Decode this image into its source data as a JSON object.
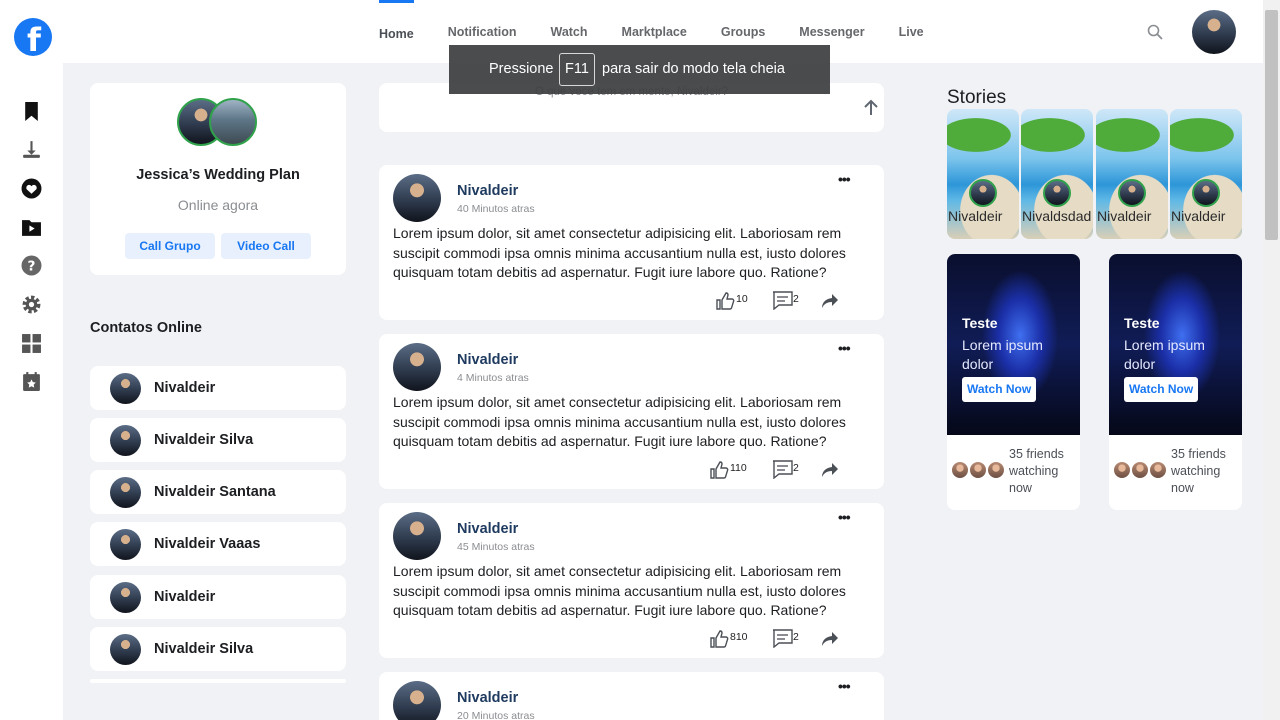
{
  "app": {
    "logo_letter": "f"
  },
  "nav": {
    "items": [
      "Home",
      "Notification",
      "Watch",
      "Marktplace",
      "Groups",
      "Messenger",
      "Live"
    ],
    "active": "Home"
  },
  "rail_icons": [
    "bookmark-icon",
    "upload-icon",
    "heart-icon",
    "video-folder-icon",
    "help-icon",
    "settings-icon",
    "grid-icon",
    "calendar-icon"
  ],
  "profile": {
    "name": "Jessica’s Wedding Plan",
    "status": "Online agora",
    "call_group_label": "Call Grupo",
    "video_call_label": "Video Call"
  },
  "contacts": {
    "title": "Contatos Online",
    "items": [
      "Nivaldeir",
      "Nivaldeir Silva",
      "Nivaldeir Santana",
      "Nivaldeir Vaaas",
      "Nivaldeir",
      "Nivaldeir Silva"
    ]
  },
  "composer": {
    "placeholder": "O que voce tem em mente, Nivaldeir?"
  },
  "toast": {
    "before": "Pressione",
    "key": "F11",
    "after": "para sair do modo tela cheia"
  },
  "posts": [
    {
      "author": "Nivaldeir",
      "time": "40 Minutos atras",
      "text": "Lorem ipsum dolor, sit amet consectetur adipisicing elit. Laboriosam rem suscipit commodi ipsa omnis minima accusantium nulla est, iusto dolores quisquam totam debitis ad aspernatur. Fugit iure labore quo. Ratione?",
      "likes": "10",
      "comments": "2"
    },
    {
      "author": "Nivaldeir",
      "time": "4 Minutos atras",
      "text": "Lorem ipsum dolor, sit amet consectetur adipisicing elit. Laboriosam rem suscipit commodi ipsa omnis minima accusantium nulla est, iusto dolores quisquam totam debitis ad aspernatur. Fugit iure labore quo. Ratione?",
      "likes": "110",
      "comments": "2"
    },
    {
      "author": "Nivaldeir",
      "time": "45 Minutos atras",
      "text": "Lorem ipsum dolor, sit amet consectetur adipisicing elit. Laboriosam rem suscipit commodi ipsa omnis minima accusantium nulla est, iusto dolores quisquam totam debitis ad aspernatur. Fugit iure labore quo. Ratione?",
      "likes": "810",
      "comments": "2"
    },
    {
      "author": "Nivaldeir",
      "time": "20 Minutos atras",
      "text": "",
      "likes": "",
      "comments": ""
    }
  ],
  "stories": {
    "title": "Stories",
    "items": [
      "Nivaldeir",
      "Nivaldsdad",
      "Nivaldeir",
      "Nivaldeir"
    ]
  },
  "watch_cards": [
    {
      "title": "Teste",
      "subtitle": "Lorem ipsum dolor",
      "button": "Watch Now",
      "friends_text": "35 friends watching now"
    },
    {
      "title": "Teste",
      "subtitle": "Lorem ipsum dolor",
      "button": "Watch Now",
      "friends_text": "35 friends watching now"
    }
  ],
  "colors": {
    "brand": "#1877f2",
    "online": "#31a24c",
    "background": "#f0f2f5"
  }
}
